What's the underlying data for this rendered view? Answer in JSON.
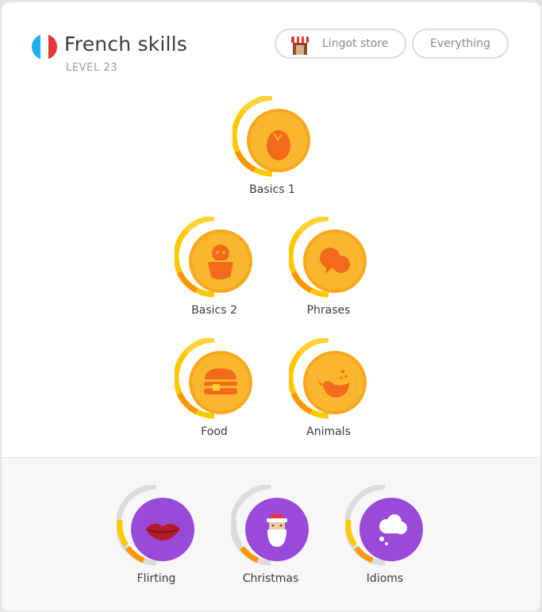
{
  "header": {
    "title": "French skills",
    "level": "LEVEL 23",
    "flag_colors": [
      "#1cb0f6",
      "#ffffff",
      "#e53838"
    ],
    "store_button": {
      "label": "Lingot store",
      "icon": "store-icon"
    },
    "filter_button": {
      "label": "Everything"
    }
  },
  "colors": {
    "gold": "#f9a81b",
    "gold_ring": "#ffd336",
    "gold_ring_dark": "#ffc800",
    "ring_orange": "#ff9600",
    "icon_orange": "#f26b1d",
    "purple": "#9a4ad9",
    "ring_gray": "#dcdcdc"
  },
  "main_skills": [
    {
      "name": "Basics 1",
      "icon": "egg-icon",
      "status": "complete"
    },
    {
      "name": "Basics 2",
      "icon": "chick-icon",
      "status": "complete"
    },
    {
      "name": "Phrases",
      "icon": "speech-bubbles-icon",
      "status": "complete"
    },
    {
      "name": "Food",
      "icon": "burger-icon",
      "status": "complete"
    },
    {
      "name": "Animals",
      "icon": "whale-icon",
      "status": "complete"
    }
  ],
  "bonus_skills": [
    {
      "name": "Flirting",
      "icon": "lips-icon",
      "status": "bonus"
    },
    {
      "name": "Christmas",
      "icon": "santa-icon",
      "status": "bonus"
    },
    {
      "name": "Idioms",
      "icon": "thought-cloud-icon",
      "status": "bonus"
    }
  ]
}
